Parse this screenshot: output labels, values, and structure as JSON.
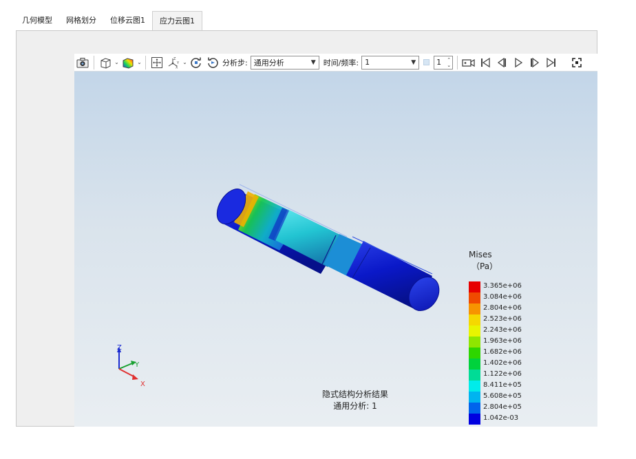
{
  "tabs": [
    {
      "label": "几何模型"
    },
    {
      "label": "网格划分"
    },
    {
      "label": "位移云图1"
    },
    {
      "label": "应力云图1"
    }
  ],
  "active_tab": "应力云图1",
  "toolbar": {
    "step_label": "分析步:",
    "step_value": "通用分析",
    "time_label": "时间/频率:",
    "time_value": "1",
    "frame_value": "1"
  },
  "legend": {
    "title": "Mises",
    "unit": "（Pa）",
    "levels": [
      {
        "label": "3.365e+06",
        "color": "#e60000"
      },
      {
        "label": "3.084e+06",
        "color": "#f04a00"
      },
      {
        "label": "2.804e+06",
        "color": "#f79400"
      },
      {
        "label": "2.523e+06",
        "color": "#f5d800"
      },
      {
        "label": "2.243e+06",
        "color": "#e8f500"
      },
      {
        "label": "1.963e+06",
        "color": "#8ee600"
      },
      {
        "label": "1.682e+06",
        "color": "#2ed600"
      },
      {
        "label": "1.402e+06",
        "color": "#00d23c"
      },
      {
        "label": "1.122e+06",
        "color": "#00dc96"
      },
      {
        "label": "8.411e+05",
        "color": "#00ecea"
      },
      {
        "label": "5.608e+05",
        "color": "#00b4f0"
      },
      {
        "label": "2.804e+05",
        "color": "#0064ec"
      },
      {
        "label": "1.042e-03",
        "color": "#0000e0"
      }
    ]
  },
  "axes": {
    "z": "Z",
    "y": "Y",
    "x": "X"
  },
  "caption": {
    "line1": "隐式结构分析结果",
    "line2": "通用分析: 1"
  },
  "colors": {
    "accent": "#0064ec",
    "shaft_low": "#0a14c8",
    "shaft_mid": "#28c8c8",
    "shaft_high": "#f0c800"
  }
}
